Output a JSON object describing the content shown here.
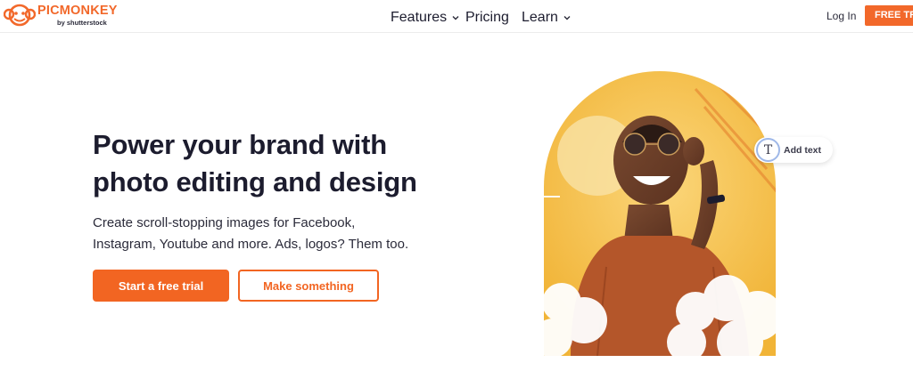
{
  "header": {
    "logo": {
      "word": "PICMONKEY",
      "sub": "by shutterstock",
      "icon": "monkey-logo-icon"
    },
    "nav": [
      {
        "label": "Features",
        "has_dropdown": true
      },
      {
        "label": "Pricing",
        "has_dropdown": false
      },
      {
        "label": "Learn",
        "has_dropdown": true
      }
    ],
    "login_label": "Log In",
    "free_trial_label": "FREE TRIAL"
  },
  "hero": {
    "headline_line1": "Power your brand with",
    "headline_line2": "photo editing and design",
    "sub_line1": "Create scroll-stopping images for Facebook,",
    "sub_line2": "Instagram, Youtube and more. Ads, logos? Them too.",
    "primary_cta": "Start a free trial",
    "secondary_cta": "Make something",
    "add_text_chip": {
      "label": "Add text",
      "icon_glyph": "T",
      "icon": "text-tool-icon"
    }
  },
  "colors": {
    "brand_orange": "#f26522",
    "text_dark": "#1c1c2e",
    "sun_yellow": "#f4c04a",
    "chip_ring": "#9fb8e8"
  }
}
